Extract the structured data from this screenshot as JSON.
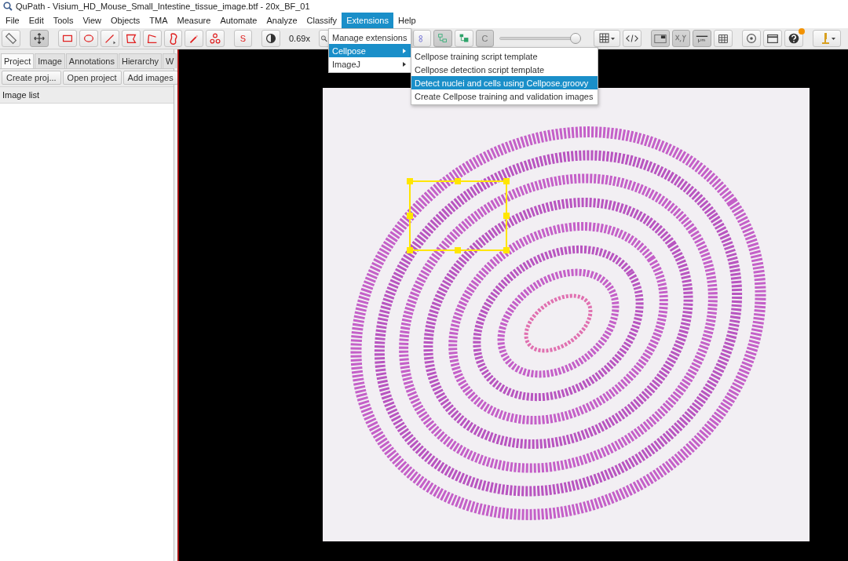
{
  "window": {
    "title": "QuPath - Visium_HD_Mouse_Small_Intestine_tissue_image.btf - 20x_BF_01"
  },
  "menu_bar": [
    {
      "label": "File",
      "selected": false
    },
    {
      "label": "Edit",
      "selected": false
    },
    {
      "label": "Tools",
      "selected": false
    },
    {
      "label": "View",
      "selected": false
    },
    {
      "label": "Objects",
      "selected": false
    },
    {
      "label": "TMA",
      "selected": false
    },
    {
      "label": "Measure",
      "selected": false
    },
    {
      "label": "Automate",
      "selected": false
    },
    {
      "label": "Analyze",
      "selected": false
    },
    {
      "label": "Classify",
      "selected": false
    },
    {
      "label": "Extensions",
      "selected": true
    },
    {
      "label": "Help",
      "selected": false
    }
  ],
  "toolbar": {
    "tools": [
      {
        "selected": false
      },
      {
        "selected": true
      },
      {
        "selected": false
      },
      {
        "selected": false
      },
      {
        "selected": false
      },
      {
        "selected": false
      },
      {
        "selected": false
      },
      {
        "selected": false
      },
      {
        "selected": false
      },
      {
        "selected": false
      }
    ],
    "selection_mode_label": "S",
    "zoom": "0.69x",
    "c_label": "C",
    "opacity_slider": {
      "level": 1.0
    }
  },
  "sidebar": {
    "tabs": [
      {
        "label": "Project",
        "selected": true
      },
      {
        "label": "Image",
        "selected": false
      },
      {
        "label": "Annotations",
        "selected": false
      },
      {
        "label": "Hierarchy",
        "selected": false
      },
      {
        "label": "W",
        "selected": false
      }
    ],
    "buttons": [
      "Create proj...",
      "Open project",
      "Add images"
    ],
    "list_header": "Image list"
  },
  "extensions_menu": [
    {
      "label": "Manage extensions",
      "submenu": false,
      "selected": false
    },
    {
      "label": "Cellpose",
      "submenu": true,
      "selected": true
    },
    {
      "label": "ImageJ",
      "submenu": true,
      "selected": false
    }
  ],
  "cellpose_submenu": [
    {
      "label": "Cellpose training script template",
      "selected": false
    },
    {
      "label": "Cellpose detection script template",
      "selected": false
    },
    {
      "label": "Detect nuclei and cells using Cellpose.groovy",
      "selected": true
    },
    {
      "label": "Create Cellpose training and validation images",
      "selected": false
    }
  ]
}
